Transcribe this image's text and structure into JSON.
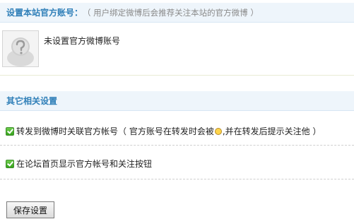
{
  "official_account": {
    "title": "设置本站官方账号：",
    "note": "（ 用户绑定微博后会推荐关注本站的官方微博 ）",
    "avatar_icon": "question-avatar-icon",
    "status_text": "未设置官方微博账号"
  },
  "other_settings": {
    "title": "其它相关设置",
    "options": [
      {
        "checked": true,
        "label_before_icon": "转发到微博时关联官方帐号（ 官方账号在转发时会被",
        "inline_icon": "at-emoticon-icon",
        "label_after_icon": ",并在转发后提示关注他 ）"
      },
      {
        "checked": true,
        "label": "在论坛首页显示官方帐号和关注按钮"
      }
    ]
  },
  "actions": {
    "save_label": "保存设置"
  },
  "colors": {
    "section_title": "#2f7fb8",
    "header_bg": "#eef5fb",
    "checkbox": "#35a21b"
  }
}
